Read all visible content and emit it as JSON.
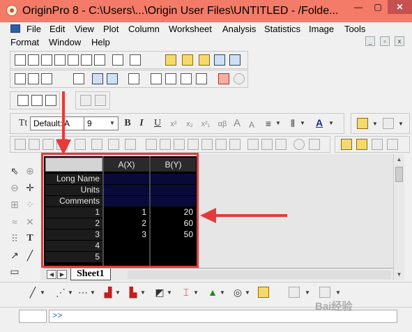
{
  "window": {
    "title": "OriginPro 8 - C:\\Users\\...\\Origin User Files\\UNTITLED - /Folde...",
    "minimize": "—",
    "maximize": "▢",
    "close": "✕"
  },
  "menu": {
    "row1": [
      "File",
      "Edit",
      "View",
      "Plot",
      "Column",
      "Worksheet",
      "Analysis",
      "Statistics",
      "Image",
      "Tools"
    ],
    "row2": [
      "Format",
      "Window",
      "Help"
    ]
  },
  "format_toolbar": {
    "font_name": "Default: A",
    "font_size": "9",
    "bold": "B",
    "italic": "I",
    "underline": "U",
    "superscript": "x²",
    "subscript": "x₂",
    "supsub": "x²₁",
    "greek": "αβ",
    "grow_font": "A",
    "shrink_font": "A"
  },
  "worksheet": {
    "columns": [
      "A(X)",
      "B(Y)"
    ],
    "meta_rows": [
      "Long Name",
      "Units",
      "Comments"
    ],
    "row_labels": [
      "1",
      "2",
      "3",
      "4",
      "5"
    ],
    "data": [
      [
        "1",
        "20"
      ],
      [
        "2",
        "60"
      ],
      [
        "3",
        "50"
      ],
      [
        "",
        ""
      ],
      [
        "",
        ""
      ]
    ],
    "sheet_tab": "Sheet1"
  },
  "command_window": {
    "prompt": ">>"
  },
  "watermark": "Bai经验",
  "colors": {
    "annotation": "#e63a3a",
    "titlebar": "#f47b67",
    "sheet_background": "#000000"
  }
}
